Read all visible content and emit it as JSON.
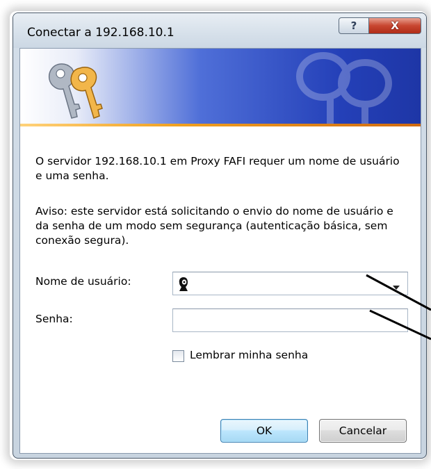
{
  "window": {
    "title": "Conectar a 192.168.10.1",
    "help_glyph": "?",
    "close_glyph": "X"
  },
  "message": {
    "line1": "O servidor 192.168.10.1 em Proxy FAFI  requer um nome de usuário e uma senha.",
    "warning": "Aviso: este servidor está solicitando o envio do nome de usuário e da senha de um modo sem segurança (autenticação básica, sem conexão segura)."
  },
  "form": {
    "username_label": "Nome de usuário:",
    "username_value": "",
    "password_label": "Senha:",
    "password_value": "",
    "remember_label": "Lembrar minha senha",
    "remember_checked": false
  },
  "buttons": {
    "ok_label": "OK",
    "cancel_label": "Cancelar"
  },
  "icons": {
    "banner": "keys-icon",
    "username_prefix": "user-icon",
    "dropdown": "chevron-down-icon"
  },
  "colors": {
    "banner_blue": "#2440b8",
    "banner_stripe": "#f0a020",
    "close_red": "#c84630",
    "ok_border": "#3c7fb1"
  }
}
